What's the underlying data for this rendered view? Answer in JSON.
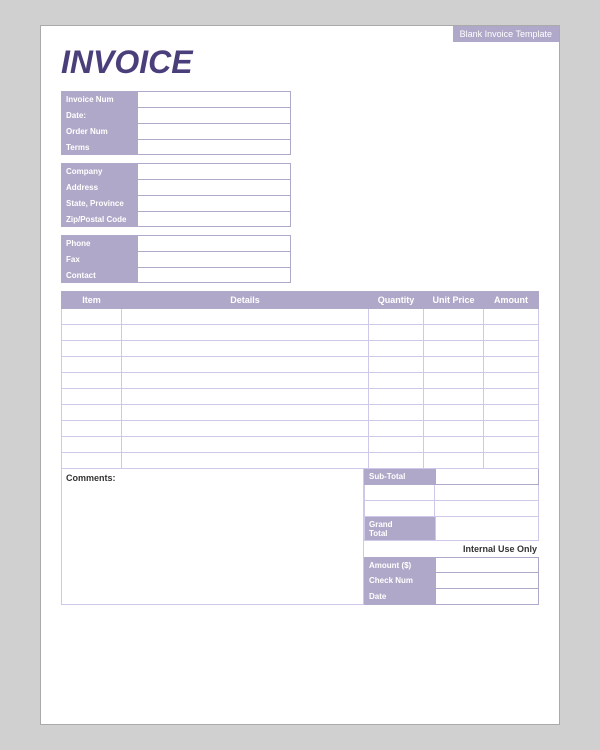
{
  "template_label": "Blank Invoice Template",
  "invoice_title": "INVOICE",
  "info_fields": [
    {
      "label": "Invoice Num",
      "value": ""
    },
    {
      "label": "Date:",
      "value": ""
    },
    {
      "label": "Order Num",
      "value": ""
    },
    {
      "label": "Terms",
      "value": ""
    }
  ],
  "company_fields": [
    {
      "label": "Company",
      "value": ""
    },
    {
      "label": "Address",
      "value": ""
    },
    {
      "label": "State, Province",
      "value": ""
    },
    {
      "label": "Zip/Postal Code",
      "value": ""
    }
  ],
  "contact_fields": [
    {
      "label": "Phone",
      "value": ""
    },
    {
      "label": "Fax",
      "value": ""
    },
    {
      "label": "Contact",
      "value": ""
    }
  ],
  "table_headers": {
    "item": "Item",
    "details": "Details",
    "quantity": "Quantity",
    "unit_price": "Unit Price",
    "amount": "Amount"
  },
  "item_rows": 10,
  "comments_label": "Comments:",
  "sub_total_label": "Sub-Total",
  "grand_total_label": "Grand\nTotal",
  "internal_use_label": "Internal Use Only",
  "payment_fields": [
    {
      "label": "Amount ($)",
      "value": ""
    },
    {
      "label": "Check Num",
      "value": ""
    },
    {
      "label": "Date",
      "value": ""
    }
  ]
}
